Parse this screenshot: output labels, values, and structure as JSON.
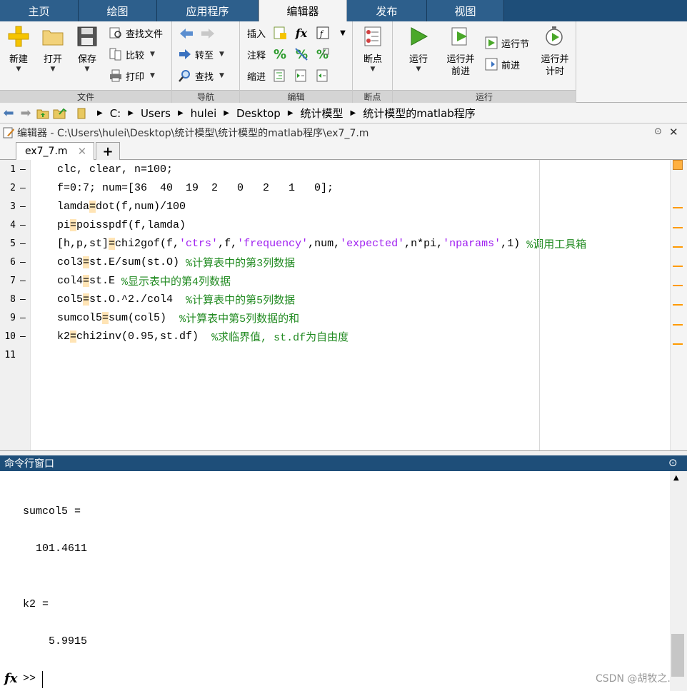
{
  "tabs": [
    "主页",
    "绘图",
    "应用程序",
    "编辑器",
    "发布",
    "视图"
  ],
  "ribbon": {
    "file": {
      "footer": "文件",
      "new": "新建",
      "open": "打开",
      "save": "保存",
      "find_file": "查找文件",
      "compare": "比较",
      "print": "打印"
    },
    "nav": {
      "footer": "导航",
      "goto": "转至",
      "find": "查找"
    },
    "edit": {
      "footer": "编辑",
      "insert": "插入",
      "comment": "注释",
      "indent": "缩进",
      "fx": "fx"
    },
    "breakpoints": {
      "footer": "断点",
      "label": "断点"
    },
    "run": {
      "footer": "运行",
      "run": "运行",
      "run_advance": "运行并前进",
      "run_section": "运行节",
      "advance": "前进",
      "run_time": "运行并计时"
    }
  },
  "address": {
    "path": [
      "C:",
      "Users",
      "hulei",
      "Desktop",
      "统计模型",
      "统计模型的matlab程序"
    ]
  },
  "editor": {
    "title": "编辑器 - C:\\Users\\hulei\\Desktop\\统计模型\\统计模型的matlab程序\\ex7_7.m",
    "tab": "ex7_7.m",
    "line_numbers": [
      "1",
      "2",
      "3",
      "4",
      "5",
      "6",
      "7",
      "8",
      "9",
      "10",
      "11"
    ],
    "lines": [
      [
        {
          "t": "clc, clear, n=100;",
          "c": "kw"
        }
      ],
      [
        {
          "t": "f=0:7; num=[36  40  19  2   0   2   1   0];",
          "c": "kw"
        }
      ],
      [
        {
          "t": "lamda",
          "c": "kw"
        },
        {
          "t": "=",
          "c": "hl"
        },
        {
          "t": "dot(f,num)/100",
          "c": "kw"
        }
      ],
      [
        {
          "t": "pi",
          "c": "kw"
        },
        {
          "t": "=",
          "c": "hl"
        },
        {
          "t": "poisspdf(f,lamda)",
          "c": "kw"
        }
      ],
      [
        {
          "t": "[h,p,st]",
          "c": "kw"
        },
        {
          "t": "=",
          "c": "hl"
        },
        {
          "t": "chi2gof(f,",
          "c": "kw"
        },
        {
          "t": "'ctrs'",
          "c": "str"
        },
        {
          "t": ",f,",
          "c": "kw"
        },
        {
          "t": "'frequency'",
          "c": "str"
        },
        {
          "t": ",num,",
          "c": "kw"
        },
        {
          "t": "'expected'",
          "c": "str"
        },
        {
          "t": ",n*pi,",
          "c": "kw"
        },
        {
          "t": "'nparams'",
          "c": "str"
        },
        {
          "t": ",1) ",
          "c": "kw"
        },
        {
          "t": "%调用工具箱",
          "c": "cmt"
        }
      ],
      [
        {
          "t": "col3",
          "c": "kw"
        },
        {
          "t": "=",
          "c": "hl"
        },
        {
          "t": "st.E/sum(st.O) ",
          "c": "kw"
        },
        {
          "t": "%计算表中的第3列数据",
          "c": "cmt"
        }
      ],
      [
        {
          "t": "col4",
          "c": "kw"
        },
        {
          "t": "=",
          "c": "hl"
        },
        {
          "t": "st.E ",
          "c": "kw"
        },
        {
          "t": "%显示表中的第4列数据",
          "c": "cmt"
        }
      ],
      [
        {
          "t": "col5",
          "c": "kw"
        },
        {
          "t": "=",
          "c": "hl"
        },
        {
          "t": "st.O.^2./col4  ",
          "c": "kw"
        },
        {
          "t": "%计算表中的第5列数据",
          "c": "cmt"
        }
      ],
      [
        {
          "t": "sumcol5",
          "c": "kw"
        },
        {
          "t": "=",
          "c": "hl"
        },
        {
          "t": "sum(col5)  ",
          "c": "kw"
        },
        {
          "t": "%计算表中第5列数据的和",
          "c": "cmt"
        }
      ],
      [
        {
          "t": "k2",
          "c": "kw"
        },
        {
          "t": "=",
          "c": "hl"
        },
        {
          "t": "chi2inv(0.95,st.df)  ",
          "c": "kw"
        },
        {
          "t": "%求临界值, st.df为自由度",
          "c": "cmt"
        }
      ],
      []
    ]
  },
  "command_window": {
    "title": "命令行窗口",
    "output": [
      "sumcol5 =",
      "  101.4611",
      "k2 =",
      "    5.9915"
    ],
    "prompt": ">>"
  },
  "watermark": "CSDN @胡牧之."
}
